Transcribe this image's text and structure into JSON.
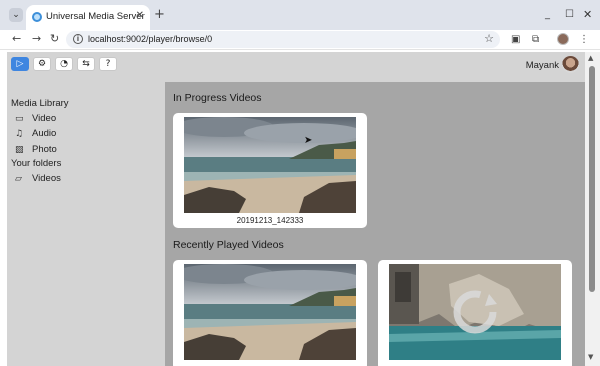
{
  "browser": {
    "tab_title": "Universal Media Server",
    "url": "localhost:9002/player/browse/0",
    "icons": {
      "tab_menu": "chevron-down-icon",
      "tab_close": "close-icon",
      "new_tab": "plus-icon",
      "back": "arrow-left-icon",
      "forward": "arrow-right-icon",
      "reload": "reload-icon",
      "site_info": "info-icon",
      "bookmark": "star-icon",
      "minimize": "minimize-icon",
      "maximize": "maximize-icon",
      "close_window": "close-icon"
    }
  },
  "header": {
    "user_name": "Mayank",
    "buttons": [
      "play-icon",
      "gear-icon",
      "history-icon",
      "shuffle-icon",
      "help-icon"
    ],
    "accent": "#3f86e0"
  },
  "sidebar": {
    "media_library": "Media Library",
    "items": [
      {
        "label": "Video",
        "icon": "video-icon"
      },
      {
        "label": "Audio",
        "icon": "music-icon"
      },
      {
        "label": "Photo",
        "icon": "image-icon"
      }
    ],
    "your_folders": "Your folders",
    "folders": [
      {
        "label": "Videos",
        "icon": "folder-icon"
      }
    ]
  },
  "main": {
    "in_progress_title": "In Progress Videos",
    "in_progress": [
      {
        "name": "20191213_142333"
      }
    ],
    "recently_played_title": "Recently Played Videos"
  }
}
